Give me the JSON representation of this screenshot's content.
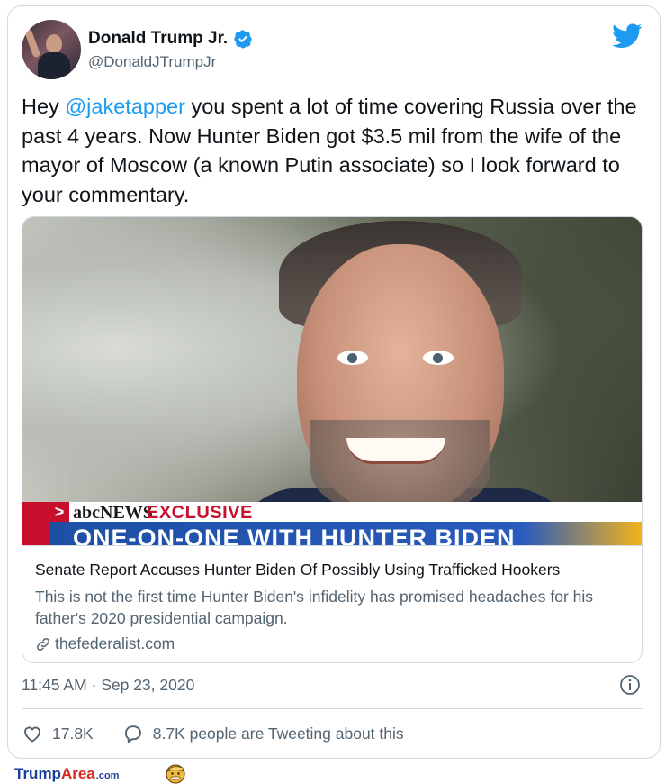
{
  "tweet": {
    "author_name": "Donald Trump Jr.",
    "author_handle": "@DonaldJTrumpJr",
    "text_pre": "Hey ",
    "mention": "@jaketapper",
    "text_post": " you spent a lot of time covering Russia over the past 4 years. Now Hunter Biden got $3.5 mil from the wife of the mayor of Moscow (a known Putin associate) so I look forward to your commentary.",
    "timestamp": "11:45 AM · Sep 23, 2020"
  },
  "link_card": {
    "lower_third_brand": "NEWS",
    "lower_third_tag": "EXCLUSIVE",
    "lower_third_headline": "ONE-ON-ONE WITH HUNTER BIDEN",
    "title": "Senate Report Accuses Hunter Biden Of Possibly Using Trafficked Hookers",
    "description": "This is not the first time Hunter Biden's infidelity has promised headaches for his father's 2020 presidential campaign.",
    "domain": "thefederalist.com"
  },
  "actions": {
    "likes": "17.8K",
    "tweeting": "8.7K people are Tweeting about this"
  },
  "watermark": {
    "trump": "Trump",
    "area": "Area",
    "com": ".com"
  },
  "icons": {
    "verified": "verified-badge-icon",
    "brand": "twitter-bird-icon",
    "link": "link-icon",
    "info": "info-icon",
    "like": "heart-icon",
    "reply": "speech-bubble-icon"
  },
  "colors": {
    "accent": "#1d9bf0",
    "text": "#0f1419",
    "muted": "#536471",
    "border": "#cfd9de"
  }
}
